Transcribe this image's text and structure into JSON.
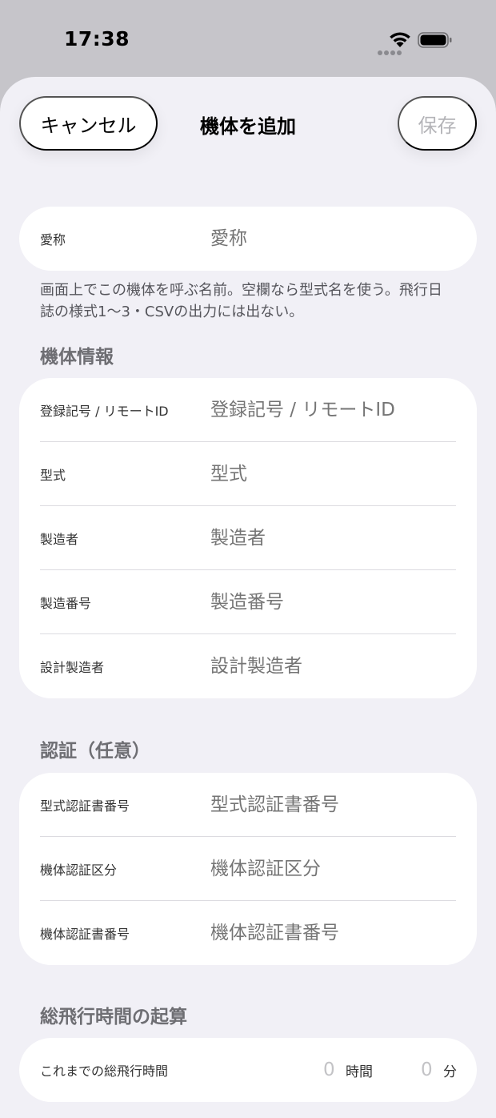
{
  "status": {
    "time": "17:38"
  },
  "nav": {
    "cancel_label": "キャンセル",
    "title": "機体を追加",
    "save_label": "保存"
  },
  "nickname": {
    "label": "愛称",
    "placeholder": "愛称",
    "note": "画面上でこの機体を呼ぶ名前。空欄なら型式名を使う。飛行日誌の様式1〜3・CSVの出力には出ない。"
  },
  "aircraft_info": {
    "header": "機体情報",
    "rows": [
      {
        "label": "登録記号 / リモートID",
        "placeholder": "登録記号 / リモートID"
      },
      {
        "label": "型式",
        "placeholder": "型式"
      },
      {
        "label": "製造者",
        "placeholder": "製造者"
      },
      {
        "label": "製造番号",
        "placeholder": "製造番号"
      },
      {
        "label": "設計製造者",
        "placeholder": "設計製造者"
      }
    ]
  },
  "certification": {
    "header": "認証（任意）",
    "rows": [
      {
        "label": "型式認証書番号",
        "placeholder": "型式認証書番号"
      },
      {
        "label": "機体認証区分",
        "placeholder": "機体認証区分"
      },
      {
        "label": "機体認証書番号",
        "placeholder": "機体認証書番号"
      }
    ]
  },
  "flight_time": {
    "header": "総飛行時間の起算",
    "row_label": "これまでの総飛行時間",
    "hours_value": "0",
    "hours_unit": "時間",
    "minutes_value": "0",
    "minutes_unit": "分"
  },
  "colors": {
    "sheet_bg": "#f1f0f6",
    "card_bg": "#ffffff",
    "placeholder": "#c3c3c6",
    "section_header": "#6e6e73",
    "save_disabled": "#b4b4b8"
  },
  "icons": [
    "wifi-icon",
    "battery-icon",
    "cellular-signal-icon"
  ]
}
